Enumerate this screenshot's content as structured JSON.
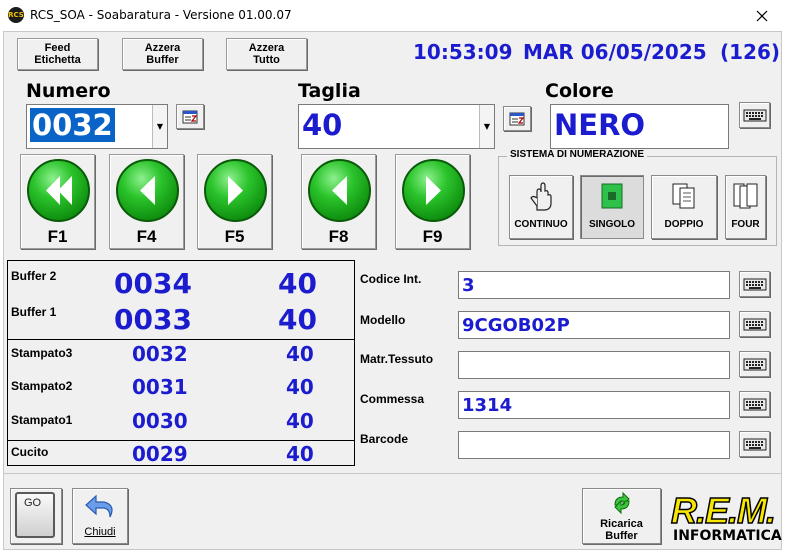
{
  "window": {
    "title": "RCS_SOA - Soabaratura - Versione 01.00.07",
    "icon_text": "RCS"
  },
  "toolbar": {
    "feed_label_1": "Feed",
    "feed_label_2": "Etichetta",
    "azzera_buffer_1": "Azzera",
    "azzera_buffer_2": "Buffer",
    "azzera_tutto_1": "Azzera",
    "azzera_tutto_2": "Tutto"
  },
  "status": {
    "time": "10:53:09",
    "date": "MAR 06/05/2025",
    "count": "(126)"
  },
  "numero": {
    "label": "Numero",
    "value": "0032"
  },
  "taglia": {
    "label": "Taglia",
    "value": "40"
  },
  "colore": {
    "label": "Colore",
    "value": "NERO"
  },
  "nav_buttons": {
    "f1": "F1",
    "f4": "F4",
    "f5": "F5",
    "f8": "F8",
    "f9": "F9"
  },
  "numerazione": {
    "title": "SISTEMA DI NUMERAZIONE",
    "continuo": "CONTINUO",
    "singolo": "SINGOLO",
    "doppio": "DOPPIO",
    "four": "FOUR",
    "selected": "SINGOLO"
  },
  "buffer_panel": {
    "buffer2": {
      "label": "Buffer 2",
      "numero": "0034",
      "taglia": "40"
    },
    "buffer1": {
      "label": "Buffer 1",
      "numero": "0033",
      "taglia": "40"
    },
    "stampato3": {
      "label": "Stampato3",
      "numero": "0032",
      "taglia": "40"
    },
    "stampato2": {
      "label": "Stampato2",
      "numero": "0031",
      "taglia": "40"
    },
    "stampato1": {
      "label": "Stampato1",
      "numero": "0030",
      "taglia": "40"
    },
    "cucito": {
      "label": "Cucito",
      "numero": "0029",
      "taglia": "40"
    }
  },
  "fields": {
    "codice_int": {
      "label": "Codice Int.",
      "value": "3"
    },
    "modello": {
      "label": "Modello",
      "value": "9CGOB02P"
    },
    "matr_tessuto": {
      "label": "Matr.Tessuto",
      "value": ""
    },
    "commessa": {
      "label": "Commessa",
      "value": "1314"
    },
    "barcode": {
      "label": "Barcode",
      "value": ""
    }
  },
  "bottom": {
    "go_label": "GO",
    "chiudi_label": "Chiudi",
    "ricarica_1": "Ricarica",
    "ricarica_2": "Buffer",
    "logo_1": "R.E.M.",
    "logo_2": "INFORMATICA"
  },
  "colors": {
    "value_blue": "#1c1ccf",
    "accent_green": "#2cc42c",
    "logo_yellow": "#f7e600"
  }
}
